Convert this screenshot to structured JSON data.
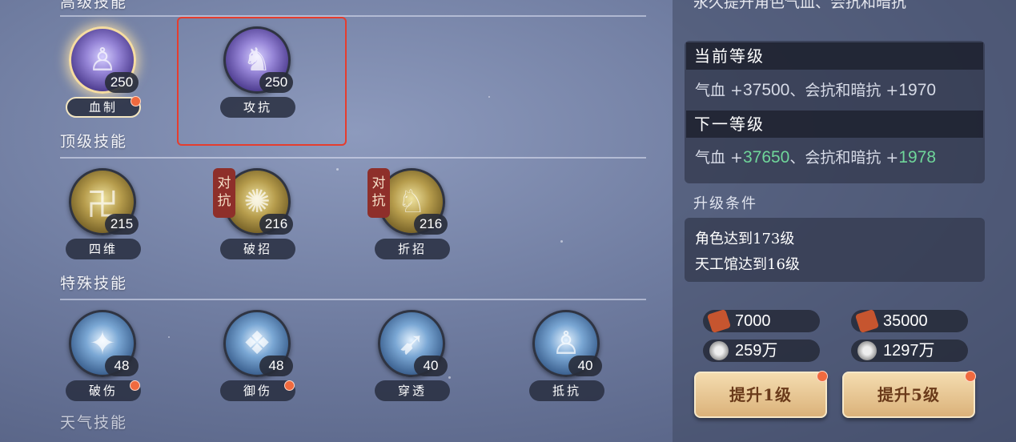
{
  "sections": {
    "advanced_title": "高级技能",
    "top_title": "顶级技能",
    "special_title": "特殊技能",
    "next_title": "天气技能"
  },
  "skills": {
    "advanced": [
      {
        "name": "血制",
        "level": "250"
      },
      {
        "name": "攻抗",
        "level": "250"
      }
    ],
    "top": [
      {
        "name": "四维",
        "level": "215"
      },
      {
        "name": "破招",
        "level": "216",
        "tag": "对抗"
      },
      {
        "name": "折招",
        "level": "216",
        "tag": "对抗"
      }
    ],
    "special": [
      {
        "name": "破伤",
        "level": "48"
      },
      {
        "name": "御伤",
        "level": "48"
      },
      {
        "name": "穿透",
        "level": "40"
      },
      {
        "name": "抵抗",
        "level": "40"
      }
    ]
  },
  "panel": {
    "top_text": "永久提升角色气血、会抗和暗抗",
    "current_label": "当前等级",
    "current_stat": {
      "a": "气血 +",
      "a_val": "37500",
      "b": "、会抗和暗抗 +",
      "b_val": "1970"
    },
    "next_label": "下一等级",
    "next_stat": {
      "a": "气血 +",
      "a_val": "37650",
      "b": "、会抗和暗抗 +",
      "b_val": "1978"
    },
    "cond_title": "升级条件",
    "conditions": [
      "角色达到173级",
      "天工馆达到16级"
    ],
    "cost1": {
      "token": "7000",
      "coin": "259万"
    },
    "cost5": {
      "token": "35000",
      "coin": "1297万"
    },
    "btn1": "提升1级",
    "btn5": "提升5级"
  },
  "colors": {
    "accent_green": "#6fd69a",
    "highlight_red": "#e53d2e",
    "badge_red": "#f06a3f"
  }
}
